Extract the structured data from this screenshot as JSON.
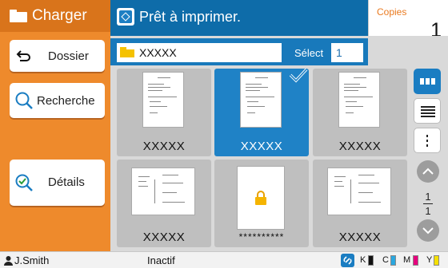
{
  "left_panel": {
    "title": "Charger",
    "buttons": [
      {
        "label": "Dossier"
      },
      {
        "label": "Recherche"
      },
      {
        "label": "Détails"
      }
    ]
  },
  "topbar": {
    "title": "Prêt à imprimer."
  },
  "copies": {
    "label": "Copies",
    "value": "1"
  },
  "folder": {
    "name": "XXXXX",
    "select_label": "Sélect",
    "select_value": "1"
  },
  "thumbnails": [
    {
      "caption": "XXXXX",
      "selected": false
    },
    {
      "caption": "XXXXX",
      "selected": true
    },
    {
      "caption": "XXXXX",
      "selected": false
    },
    {
      "caption": "XXXXX",
      "selected": false
    },
    {
      "caption": "**********",
      "selected": false,
      "locked": true
    },
    {
      "caption": "XXXXX",
      "selected": false
    }
  ],
  "pager": {
    "current": "1",
    "total": "1"
  },
  "status": {
    "user": "J.Smith",
    "state": "Inactif",
    "inks": [
      {
        "label": "K",
        "color": "#111111"
      },
      {
        "label": "C",
        "color": "#2aa7df"
      },
      {
        "label": "M",
        "color": "#e6007e"
      },
      {
        "label": "Y",
        "color": "#f5e000"
      }
    ]
  },
  "colors": {
    "accent_orange": "#ee8a2c",
    "accent_blue": "#1a7dc2"
  }
}
